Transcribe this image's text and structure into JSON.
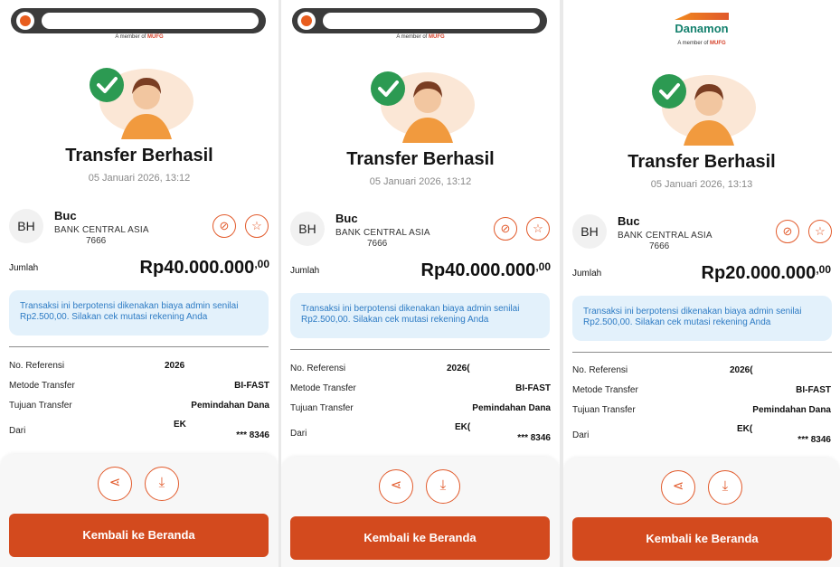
{
  "panels": [
    {
      "member_text": "A member of",
      "member_brand": "MUFG",
      "title": "Transfer Berhasil",
      "date": "05 Januari 2026, 13:12",
      "recipient": {
        "initials": "BH",
        "name": "Buc",
        "bank": "BANK CENTRAL ASIA",
        "account": "7666"
      },
      "amount_label": "Jumlah",
      "amount": "Rp40.000.000",
      "amount_cents": ",00",
      "notice": "Transaksi ini berpotensi dikenakan biaya admin senilai Rp2.500,00. Silakan cek mutasi rekening Anda",
      "details": [
        {
          "label": "No. Referensi",
          "value": "2026"
        },
        {
          "label": "Metode Transfer",
          "value": "BI-FAST"
        },
        {
          "label": "Tujuan Transfer",
          "value": "Pemindahan Dana"
        },
        {
          "label": "Dari",
          "value": "EK"
        }
      ],
      "from_account": "*** 8346",
      "home_button": "Kembali ke Beranda"
    },
    {
      "member_text": "A member of",
      "member_brand": "MUFG",
      "title": "Transfer Berhasil",
      "date": "05 Januari 2026, 13:12",
      "recipient": {
        "initials": "BH",
        "name": "Buc",
        "bank": "BANK CENTRAL ASIA",
        "account": "7666"
      },
      "amount_label": "Jumlah",
      "amount": "Rp40.000.000",
      "amount_cents": ",00",
      "notice": "Transaksi ini berpotensi dikenakan biaya admin senilai Rp2.500,00. Silakan cek mutasi rekening Anda",
      "details": [
        {
          "label": "No. Referensi",
          "value": "2026("
        },
        {
          "label": "Metode Transfer",
          "value": "BI-FAST"
        },
        {
          "label": "Tujuan Transfer",
          "value": "Pemindahan Dana"
        },
        {
          "label": "Dari",
          "value": "EK("
        }
      ],
      "from_account": "*** 8346",
      "home_button": "Kembali ke Beranda"
    },
    {
      "brand_name": "Danamon",
      "member_text": "A member of",
      "member_brand": "MUFG",
      "title": "Transfer Berhasil",
      "date": "05 Januari 2026, 13:13",
      "recipient": {
        "initials": "BH",
        "name": "Buc",
        "bank": "BANK CENTRAL ASIA",
        "account": "7666"
      },
      "amount_label": "Jumlah",
      "amount": "Rp20.000.000",
      "amount_cents": ",00",
      "notice": "Transaksi ini berpotensi dikenakan biaya admin senilai Rp2.500,00. Silakan cek mutasi rekening Anda",
      "details": [
        {
          "label": "No. Referensi",
          "value": "2026("
        },
        {
          "label": "Metode Transfer",
          "value": "BI-FAST"
        },
        {
          "label": "Tujuan Transfer",
          "value": "Pemindahan Dana"
        },
        {
          "label": "Dari",
          "value": "EK("
        }
      ],
      "from_account": "*** 8346",
      "home_button": "Kembali ke Beranda"
    }
  ],
  "icons": {
    "share": "share-icon",
    "download": "download-icon",
    "hide_share": "share-off-icon",
    "favorite": "star-icon",
    "success": "check-icon"
  },
  "colors": {
    "accent": "#d34a1e",
    "notice_bg": "#e3f1fb",
    "notice_text": "#2d7bc4",
    "success": "#2c9a52"
  }
}
